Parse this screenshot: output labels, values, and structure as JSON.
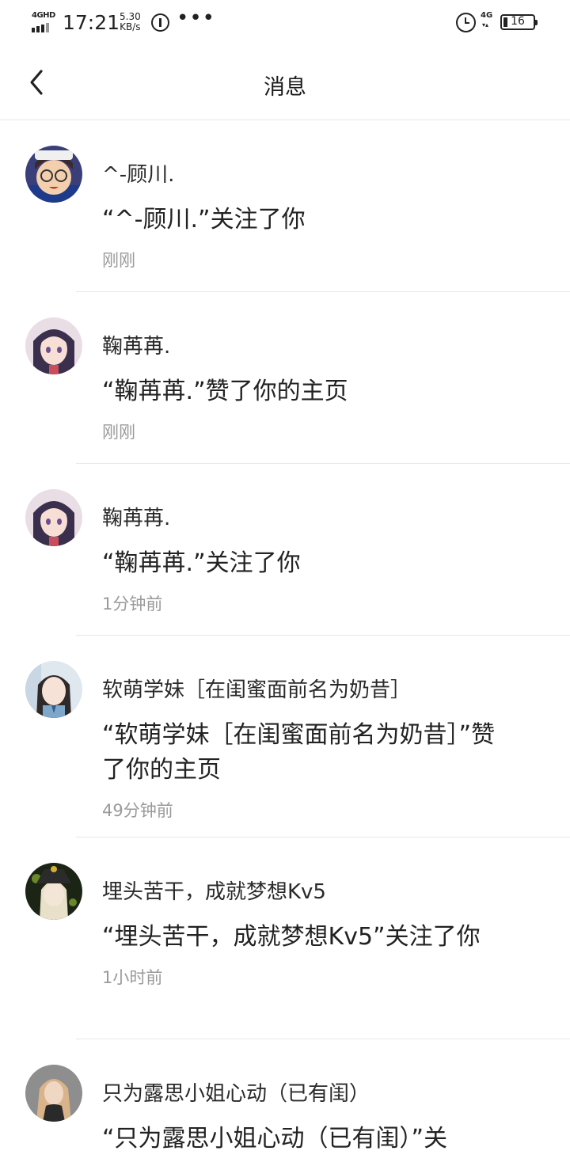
{
  "status_bar": {
    "network": "4GHD",
    "time": "17:21",
    "speed_value": "5.30",
    "speed_unit": "KB/s",
    "more_dots": "•••",
    "mobile_network": "4G",
    "battery_level": "16"
  },
  "header": {
    "title": "消息"
  },
  "messages": [
    {
      "name": "^-顾川.",
      "text": "“^-顾川.”关注了你",
      "time": "刚刚"
    },
    {
      "name": "鞠苒苒.",
      "text": "“鞠苒苒.”赞了你的主页",
      "time": "刚刚"
    },
    {
      "name": "鞠苒苒.",
      "text": "“鞠苒苒.”关注了你",
      "time": "1分钟前"
    },
    {
      "name": "软萌学妹［在闺蜜面前名为奶昔］",
      "text": "“软萌学妹［在闺蜜面前名为奶昔］”赞了你的主页",
      "time": "49分钟前"
    },
    {
      "name": "埋头苦干，成就梦想Kv5",
      "text": "“埋头苦干，成就梦想Kv5”关注了你",
      "time": "1小时前"
    },
    {
      "name": "只为露思小姐心动（已有闺）",
      "text": "“只为露思小姐心动（已有闺）”关",
      "time": ""
    }
  ]
}
